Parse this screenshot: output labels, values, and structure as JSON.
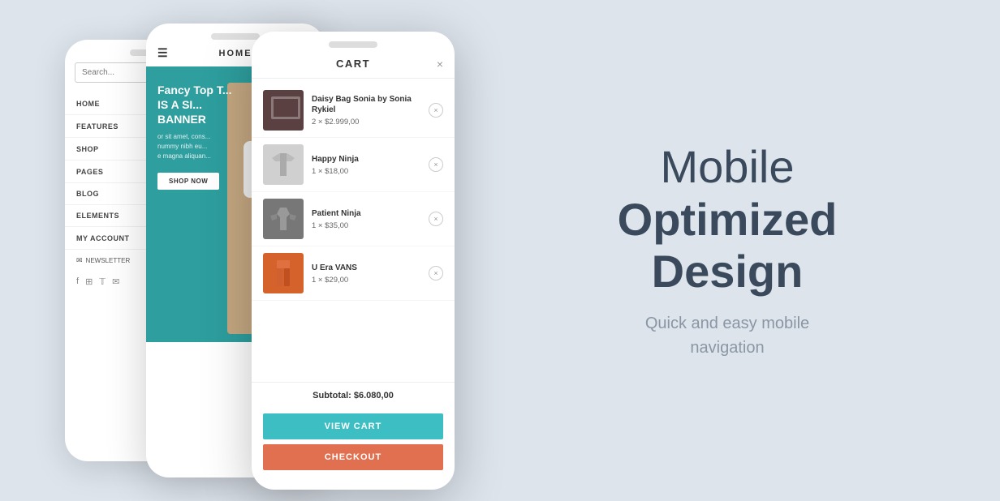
{
  "page": {
    "bg_color": "#dde4ec"
  },
  "phones": {
    "back": {
      "search_placeholder": "Search...",
      "nav_items": [
        {
          "label": "HOME",
          "has_dropdown": true
        },
        {
          "label": "FEATURES",
          "has_dropdown": true
        },
        {
          "label": "SHOP",
          "has_dropdown": true
        },
        {
          "label": "PAGES",
          "has_dropdown": true
        },
        {
          "label": "BLOG",
          "has_dropdown": false
        },
        {
          "label": "ELEMENTS",
          "has_dropdown": false
        },
        {
          "label": "MY ACCOUNT",
          "has_dropdown": true
        }
      ],
      "newsletter_label": "NEWSLETTER",
      "social_icons": [
        "f",
        "instagram",
        "twitter",
        "email"
      ]
    },
    "mid": {
      "logo": "HOME",
      "banner_title": "Fancy Top T...\nIS A SI...\nBANNER",
      "banner_text": "or sit amet, cons...\nnummy nibh eu...\ne magna aliquan...",
      "banner_btn": "SHOP NOW"
    },
    "front": {
      "cart_title": "CART",
      "close_icon": "×",
      "items": [
        {
          "name": "Daisy Bag Sonia by Sonia Rykiel",
          "qty": "2",
          "price": "$2.999,00",
          "img_type": "bag"
        },
        {
          "name": "Happy Ninja",
          "qty": "1",
          "price": "$18,00",
          "img_type": "shirt"
        },
        {
          "name": "Patient Ninja",
          "qty": "1",
          "price": "$35,00",
          "img_type": "hoodie"
        },
        {
          "name": "U Era VANS",
          "qty": "1",
          "price": "$29,00",
          "img_type": "pants"
        }
      ],
      "subtotal_label": "Subtotal:",
      "subtotal_value": "$6.080,00",
      "view_cart_label": "VIEW CART",
      "checkout_label": "CHECKOUT"
    }
  },
  "hero": {
    "title_light": "Mobile",
    "title_bold": "Optimized\nDesign",
    "subtitle": "Quick and easy mobile\nnavigation"
  }
}
